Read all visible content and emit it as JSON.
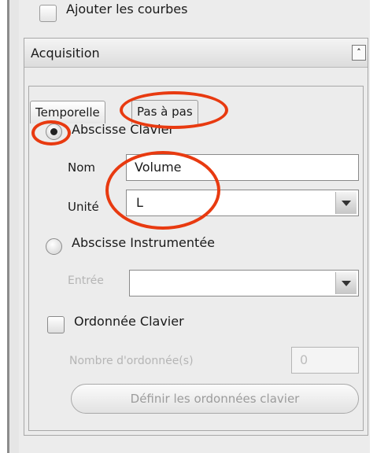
{
  "top_option": {
    "label": "Ajouter les courbes"
  },
  "acquisition": {
    "title": "Acquisition",
    "collapse_glyph": "˄",
    "tabs": [
      {
        "label": "Temporelle",
        "active": false
      },
      {
        "label": "Pas à pas",
        "active": true
      }
    ],
    "abscisse_clavier": {
      "label": "Abscisse Clavier",
      "selected": true
    },
    "nom": {
      "label": "Nom",
      "value": "Volume"
    },
    "unite": {
      "label": "Unité",
      "value": "L"
    },
    "abscisse_instrumentee": {
      "label": "Abscisse Instrumentée",
      "selected": false
    },
    "entree": {
      "label": "Entrée",
      "value": ""
    },
    "ordonnee_clavier": {
      "label": "Ordonnée Clavier",
      "checked": false
    },
    "nombre_ordonnees": {
      "label": "Nombre d'ordonnée(s)",
      "value": "0"
    },
    "definir_button": {
      "label": "Définir les ordonnées clavier"
    }
  },
  "annotation_color": "#e83a10"
}
